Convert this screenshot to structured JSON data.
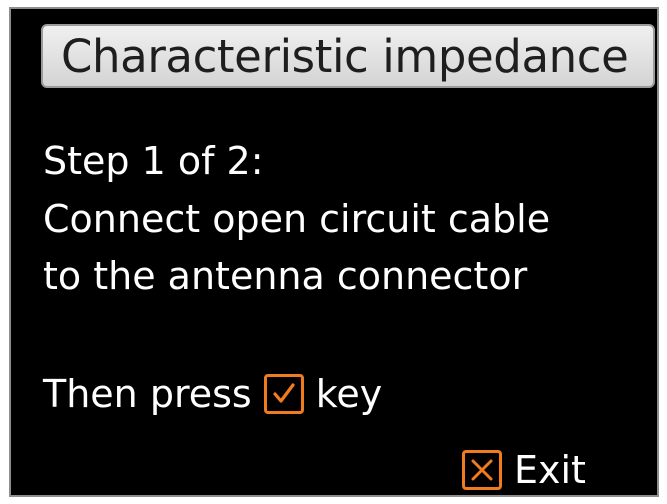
{
  "title": "Characteristic impedance",
  "step_label": "Step 1 of 2:",
  "instruction_line1": "Connect open circuit cable",
  "instruction_line2": "to the antenna connector",
  "press_prefix": "Then press",
  "press_suffix": "key",
  "confirm_icon": "checkmark-icon",
  "exit_icon": "x-icon",
  "exit_label": "Exit",
  "accent_color": "#f07c1e"
}
